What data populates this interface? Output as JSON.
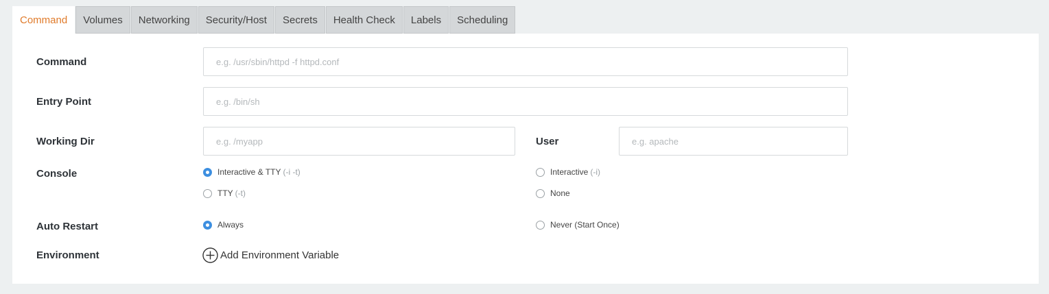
{
  "tabs": [
    {
      "label": "Command",
      "active": true
    },
    {
      "label": "Volumes"
    },
    {
      "label": "Networking"
    },
    {
      "label": "Security/Host"
    },
    {
      "label": "Secrets"
    },
    {
      "label": "Health Check"
    },
    {
      "label": "Labels"
    },
    {
      "label": "Scheduling"
    }
  ],
  "form": {
    "command": {
      "label": "Command",
      "placeholder": "e.g. /usr/sbin/httpd -f httpd.conf",
      "value": ""
    },
    "entry_point": {
      "label": "Entry Point",
      "placeholder": "e.g. /bin/sh",
      "value": ""
    },
    "working_dir": {
      "label": "Working Dir",
      "placeholder": "e.g. /myapp",
      "value": ""
    },
    "user": {
      "label": "User",
      "placeholder": "e.g. apache",
      "value": ""
    },
    "console": {
      "label": "Console",
      "options": [
        {
          "label": "Interactive & TTY",
          "hint": "(-i -t)",
          "checked": true
        },
        {
          "label": "Interactive",
          "hint": "(-i)",
          "checked": false
        },
        {
          "label": "TTY",
          "hint": "(-t)",
          "checked": false
        },
        {
          "label": "None",
          "hint": "",
          "checked": false
        }
      ]
    },
    "auto_restart": {
      "label": "Auto Restart",
      "options": [
        {
          "label": "Always",
          "checked": true
        },
        {
          "label": "Never (Start Once)",
          "checked": false
        }
      ]
    },
    "environment": {
      "label": "Environment",
      "add_label": "Add Environment Variable"
    }
  },
  "colors": {
    "accent": "#e07b2b",
    "radio_checked": "#3d8fe0"
  },
  "icons": {
    "add": "plus-circle-icon"
  }
}
